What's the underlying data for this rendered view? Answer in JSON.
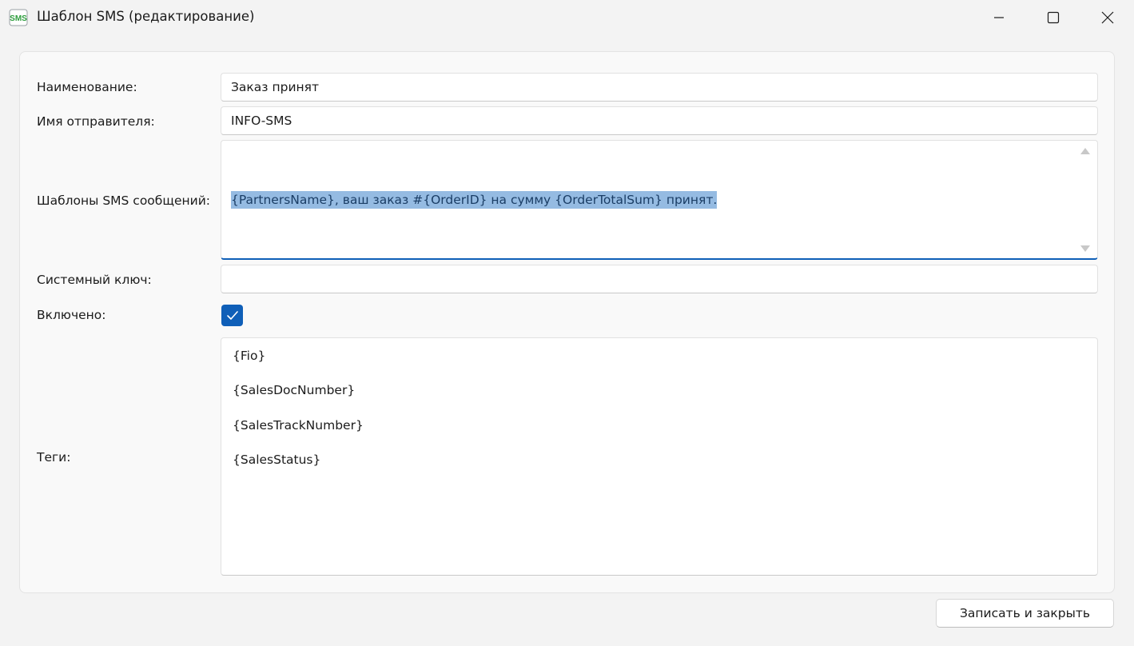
{
  "window": {
    "title": "Шаблон SMS (редактирование)",
    "app_icon_text": "SMS"
  },
  "form": {
    "name": {
      "label": "Наименование:",
      "value": "Заказ принят"
    },
    "sender": {
      "label": "Имя отправителя:",
      "value": "INFO-SMS"
    },
    "template": {
      "label": "Шаблоны SMS сообщений:",
      "value": "{PartnersName}, ваш заказ #{OrderID} на сумму {OrderTotalSum} принят."
    },
    "system_key": {
      "label": "Системный ключ:",
      "value": ""
    },
    "enabled": {
      "label": "Включено:",
      "checked": true
    },
    "tags": {
      "label": "Теги:",
      "items": [
        "{Fio}",
        "{SalesDocNumber}",
        "{SalesTrackNumber}",
        "{SalesStatus}"
      ]
    }
  },
  "footer": {
    "save_close_label": "Записать и закрыть"
  },
  "colors": {
    "accent": "#0f5fb8",
    "selection": "#95bbe2",
    "app_icon_green": "#2e9e3e"
  }
}
